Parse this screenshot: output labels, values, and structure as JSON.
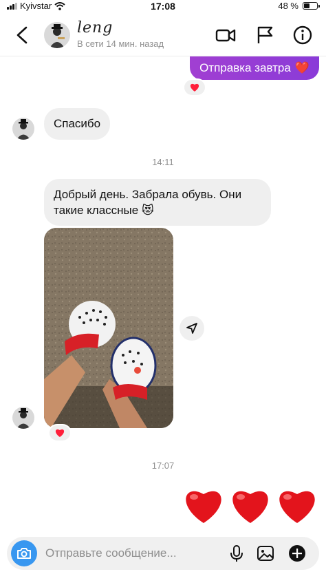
{
  "status_bar": {
    "carrier": "Kyivstar",
    "time": "17:08",
    "battery": "48 %",
    "battery_level": 0.48,
    "signal_bars": 3,
    "icons": [
      "signal-icon",
      "wifi-icon",
      "battery-icon"
    ]
  },
  "header": {
    "name": "leng",
    "status": "В сети 14 мин. назад",
    "icons": [
      "back-icon",
      "video-call-icon",
      "flag-icon",
      "info-icon"
    ]
  },
  "messages": {
    "sent_1": "Отправка завтра",
    "sent_1_emoji": "❤️",
    "received_thanks": "Спасибо",
    "timestamp_1": "14:11",
    "received_long": "Добрый день. Забрала обувь. Они такие классные",
    "received_long_emoji": "😻",
    "timestamp_2": "17:07",
    "reaction_emoji": "❤️",
    "big_hearts": [
      "❤️",
      "❤️",
      "❤️"
    ]
  },
  "composer": {
    "placeholder": "Отправьте сообщение...",
    "icons": [
      "camera-icon",
      "microphone-icon",
      "gallery-icon",
      "add-icon"
    ]
  },
  "colors": {
    "accent": "#8a3bd8",
    "camera": "#3897f0",
    "bubble": "#efefef",
    "muted": "#8e8e8e"
  }
}
